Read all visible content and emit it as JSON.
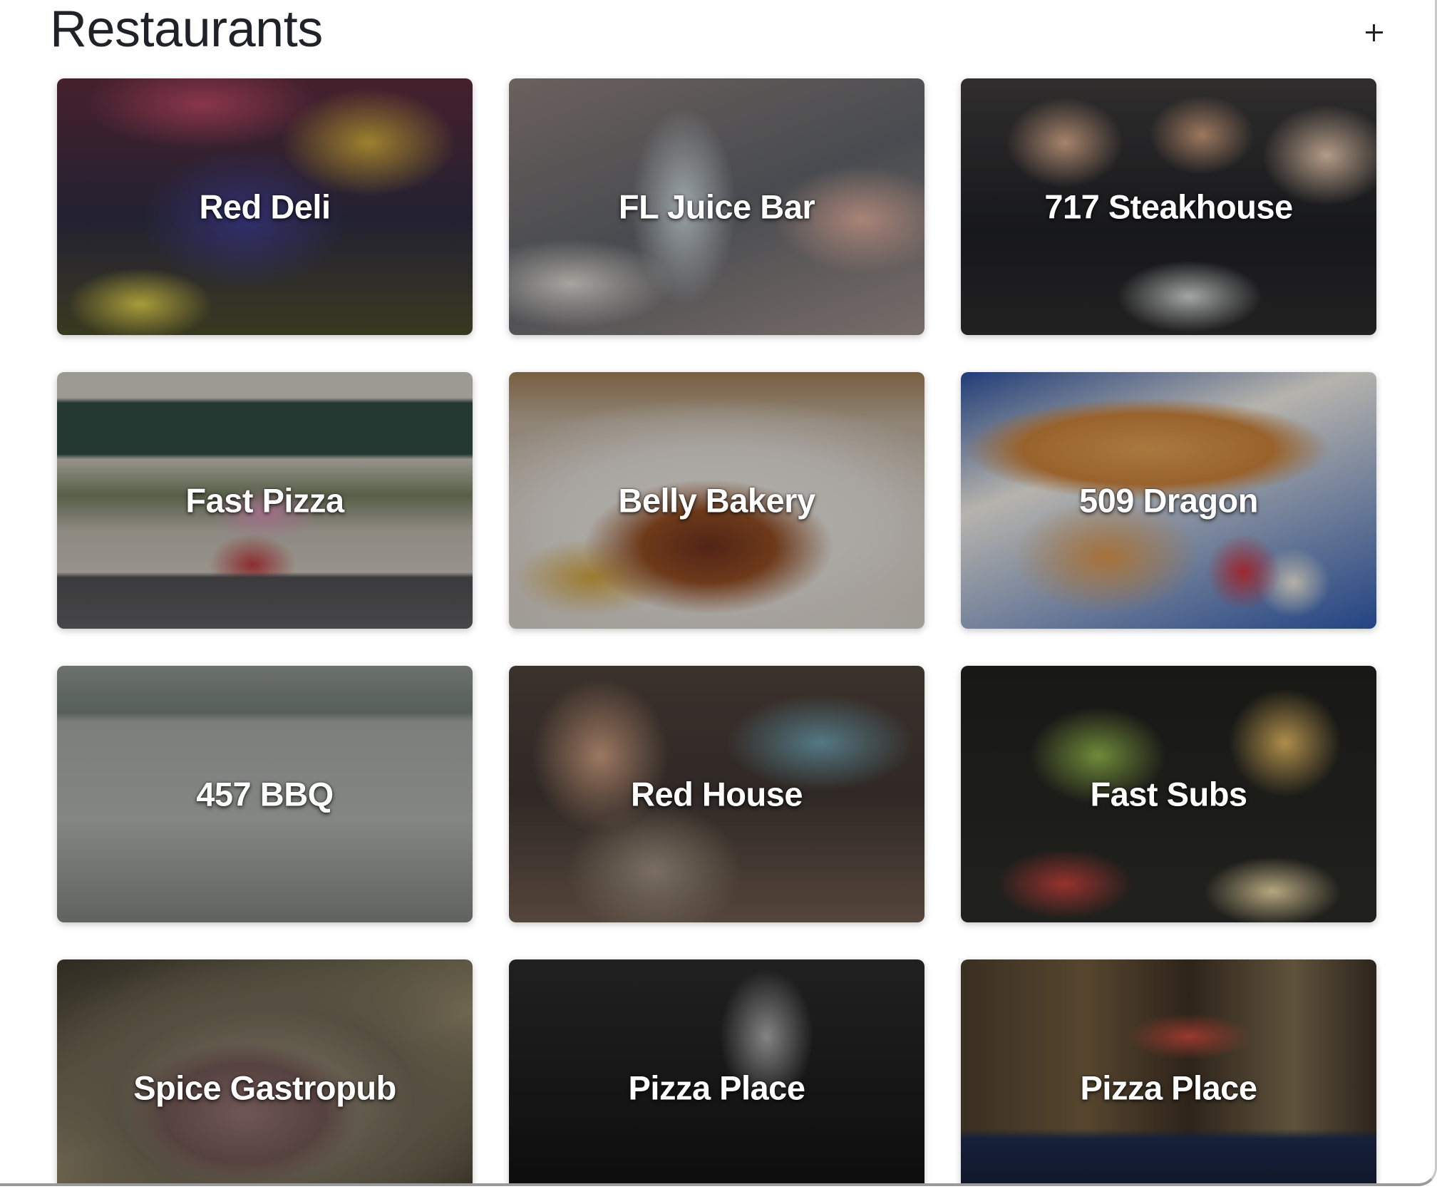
{
  "page": {
    "title": "Restaurants",
    "add_label": "+"
  },
  "restaurants": [
    {
      "name": "Red Deli"
    },
    {
      "name": "FL Juice Bar"
    },
    {
      "name": "717 Steakhouse"
    },
    {
      "name": "Fast Pizza"
    },
    {
      "name": "Belly Bakery"
    },
    {
      "name": "509 Dragon"
    },
    {
      "name": "457 BBQ"
    },
    {
      "name": "Red House"
    },
    {
      "name": "Fast Subs"
    },
    {
      "name": "Spice Gastropub"
    },
    {
      "name": "Pizza Place"
    },
    {
      "name": "Pizza Place"
    }
  ],
  "icons": {
    "add": "plus-icon"
  }
}
